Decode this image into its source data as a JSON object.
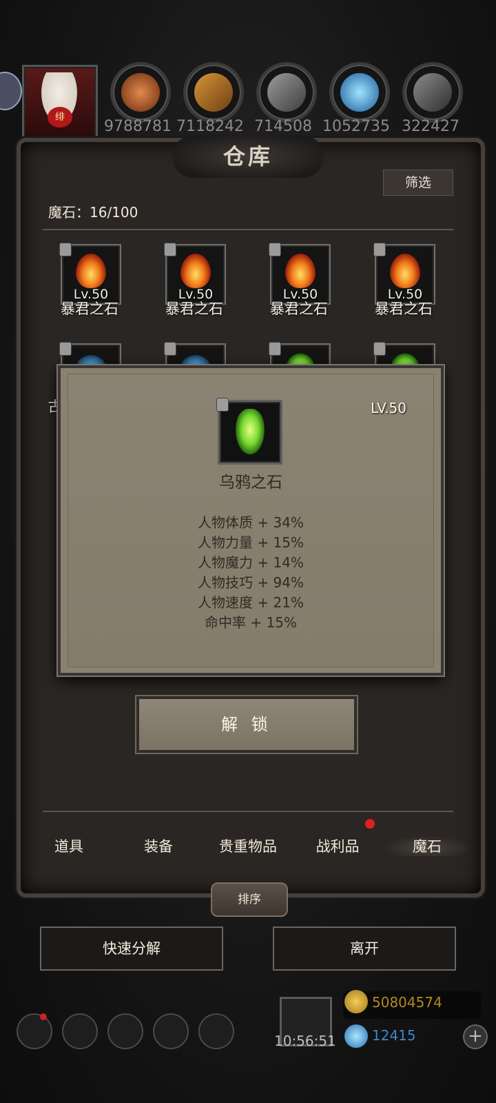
{
  "resources": [
    {
      "name": "meat",
      "value": "9788781",
      "color": "#b35a2a"
    },
    {
      "name": "wood",
      "value": "7118242",
      "color": "#a36b2a"
    },
    {
      "name": "stone",
      "value": "714508",
      "color": "#6f6f6f"
    },
    {
      "name": "crystal",
      "value": "1052735",
      "color": "#2f8acb"
    },
    {
      "name": "iron",
      "value": "322427",
      "color": "#5d5d5d"
    }
  ],
  "avatar": {
    "badge": "绯"
  },
  "panel": {
    "title": "仓库",
    "filter": "筛选",
    "stone_count": "魔石：16/100"
  },
  "grid": [
    {
      "lv": "Lv.50",
      "name": "暴君之石",
      "gem": "fire"
    },
    {
      "lv": "Lv.50",
      "name": "暴君之石",
      "gem": "fire"
    },
    {
      "lv": "Lv.50",
      "name": "暴君之石",
      "gem": "fire"
    },
    {
      "lv": "Lv.50",
      "name": "暴君之石",
      "gem": "fire"
    },
    {
      "lv": "",
      "name": "古",
      "gem": "ice"
    },
    {
      "lv": "",
      "name": "",
      "gem": "ice"
    },
    {
      "lv": "",
      "name": "",
      "gem": "green"
    },
    {
      "lv": "",
      "name": "",
      "gem": "green"
    }
  ],
  "popup": {
    "lv": "LV.50",
    "name": "乌鸦之石",
    "stats": [
      "人物体质 + 34%",
      "人物力量 + 15%",
      "人物魔力 + 14%",
      "人物技巧 + 94%",
      "人物速度 + 21%",
      "命中率 + 15%"
    ]
  },
  "unlock_button": "解 锁",
  "tabs": [
    "道具",
    "装备",
    "贵重物品",
    "战利品",
    "魔石"
  ],
  "sort_button": "排序",
  "actions": {
    "quick_decompose": "快速分解",
    "leave": "离开"
  },
  "hud": {
    "clock": "10:56:51",
    "gold": "50804574",
    "gems": "12415"
  }
}
